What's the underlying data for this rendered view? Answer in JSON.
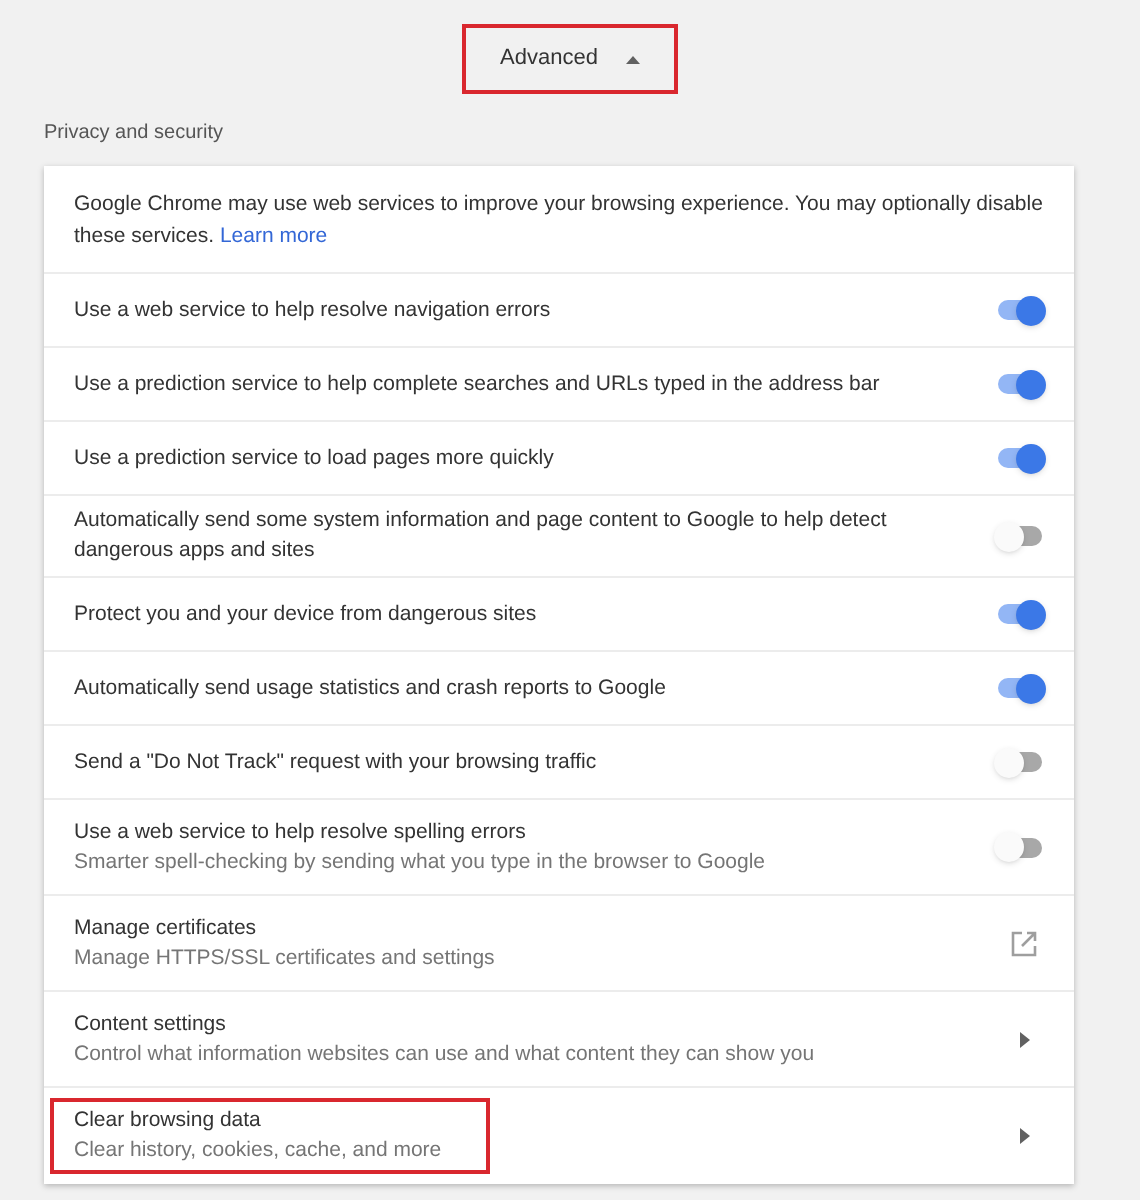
{
  "advanced_button": {
    "label": "Advanced",
    "expanded": true,
    "highlighted": true
  },
  "section": {
    "title": "Privacy and security"
  },
  "intro": {
    "text": "Google Chrome may use web services to improve your browsing experience. You may optionally disable these services.",
    "link": "Learn more"
  },
  "rows": [
    {
      "kind": "toggle",
      "title": "Use a web service to help resolve navigation errors",
      "on": true
    },
    {
      "kind": "toggle",
      "title": "Use a prediction service to help complete searches and URLs typed in the address bar",
      "on": true
    },
    {
      "kind": "toggle",
      "title": "Use a prediction service to load pages more quickly",
      "on": true
    },
    {
      "kind": "toggle",
      "title": "Automatically send some system information and page content to Google to help detect dangerous apps and sites",
      "on": false
    },
    {
      "kind": "toggle",
      "title": "Protect you and your device from dangerous sites",
      "on": true
    },
    {
      "kind": "toggle",
      "title": "Automatically send usage statistics and crash reports to Google",
      "on": true
    },
    {
      "kind": "toggle",
      "title": "Send a \"Do Not Track\" request with your browsing traffic",
      "on": false
    },
    {
      "kind": "toggle",
      "title": "Use a web service to help resolve spelling errors",
      "subtitle": "Smarter spell-checking by sending what you type in the browser to Google",
      "on": false
    },
    {
      "kind": "external",
      "title": "Manage certificates",
      "subtitle": "Manage HTTPS/SSL certificates and settings"
    },
    {
      "kind": "arrow",
      "title": "Content settings",
      "subtitle": "Control what information websites can use and what content they can show you",
      "highlighted": false
    },
    {
      "kind": "arrow",
      "title": "Clear browsing data",
      "subtitle": "Clear history, cookies, cache, and more",
      "highlighted": true
    }
  ]
}
